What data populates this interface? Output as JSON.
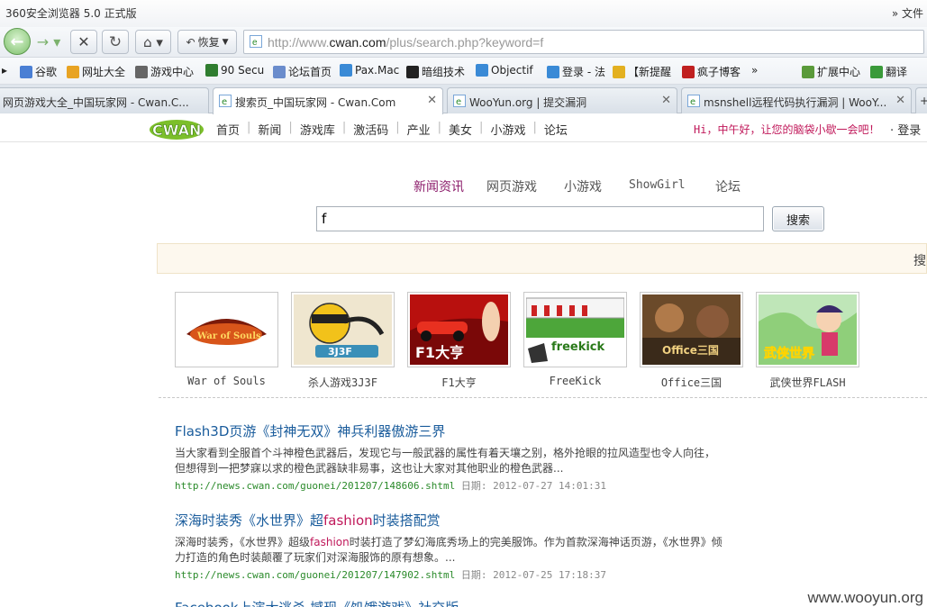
{
  "window": {
    "title": "360安全浏览器 5.0 正式版",
    "more_label": "»  文件"
  },
  "toolbar": {
    "restore_label": "恢复",
    "url_prefix": "http://www.",
    "url_domain": "cwan.com",
    "url_rest": "/plus/search.php?keyword=f"
  },
  "favorites": [
    {
      "label": "谷歌",
      "color": "#4a7fd4"
    },
    {
      "label": "网址大全",
      "color": "#e8a323"
    },
    {
      "label": "游戏中心",
      "color": "#666666"
    },
    {
      "label": "90 Secu",
      "color": "#2f7d2f"
    },
    {
      "label": "论坛首页",
      "color": "#6a8ccc"
    },
    {
      "label": "Pax.Mac",
      "color": "#3a8ad6"
    },
    {
      "label": "暗组技术",
      "color": "#222222"
    },
    {
      "label": "Objectif",
      "color": "#3a8ad6"
    },
    {
      "label": "登录 - 法",
      "color": "#3a8ad6"
    },
    {
      "label": "【新提醒",
      "color": "#e3b020"
    },
    {
      "label": "疯子博客",
      "color": "#c02020"
    },
    {
      "label": "扩展中心",
      "color": "#5a9a3a"
    },
    {
      "label": "翻译",
      "color": "#3a9a3a"
    }
  ],
  "tabs": [
    {
      "label": "网页游戏大全_中国玩家网 - Cwan.C..."
    },
    {
      "label": "搜索页_中国玩家网 - Cwan.Com"
    },
    {
      "label": "WooYun.org | 提交漏洞"
    },
    {
      "label": "msnshell远程代码执行漏洞 | WooY..."
    }
  ],
  "site": {
    "logo_text": "CWAN",
    "nav": [
      "首页",
      "新闻",
      "游戏库",
      "激活码",
      "产业",
      "美女",
      "小游戏",
      "论坛"
    ],
    "greeting": "Hi，中午好，让您的脑袋小歇一会吧！",
    "login": "· 登录"
  },
  "search": {
    "categories": [
      "新闻资讯",
      "网页游戏",
      "小游戏",
      "ShowGirl",
      "论坛"
    ],
    "active_category": "新闻资讯",
    "value": "f",
    "button": "搜索",
    "notice_edge": "搜"
  },
  "games": [
    {
      "caption": "War of Souls",
      "art_text": "War of Souls"
    },
    {
      "caption": "杀人游戏3J3F",
      "art_text": "3J3F"
    },
    {
      "caption": "F1大亨",
      "art_text": "F1大亨"
    },
    {
      "caption": "FreeKick",
      "art_text": "freekick"
    },
    {
      "caption": "Office三国",
      "art_text": "Office三国"
    },
    {
      "caption": "武侠世界FLASH",
      "art_text": "武侠世界"
    }
  ],
  "results": [
    {
      "title": "Flash3D页游《封神无双》神兵利器傲游三界",
      "title_html": "Flash3D页游《封神无双》神兵利器傲游三界",
      "desc": "当大家看到全服首个斗神橙色武器后，发现它与一般武器的属性有着天壤之别，格外抢眼的拉风造型也令人向往，但想得到一把梦寐以求的橙色武器缺非易事，这也让大家对其他职业的橙色武器...",
      "url": "http://news.cwan.com/guonei/201207/148606.shtml",
      "date": "日期: 2012-07-27 14:01:31"
    },
    {
      "title_pre": "深海时装秀《水世界》超",
      "title_hl": "fashion",
      "title_post": "时装搭配赏",
      "desc_pre": "深海时装秀，《水世界》超级",
      "desc_hl": "fashion",
      "desc_post": "时装打造了梦幻海底秀场上的完美服饰。作为首款深海神话页游，《水世界》倾力打造的角色时装颠覆了玩家们对深海服饰的原有想象。...",
      "url": "http://news.cwan.com/guonei/201207/147902.shtml",
      "date": "日期: 2012-07-25 17:18:37"
    },
    {
      "title": "Facebook上演大逃杀 撼现《饥饿游戏》社交版"
    }
  ],
  "watermark": "www.wooyun.org"
}
